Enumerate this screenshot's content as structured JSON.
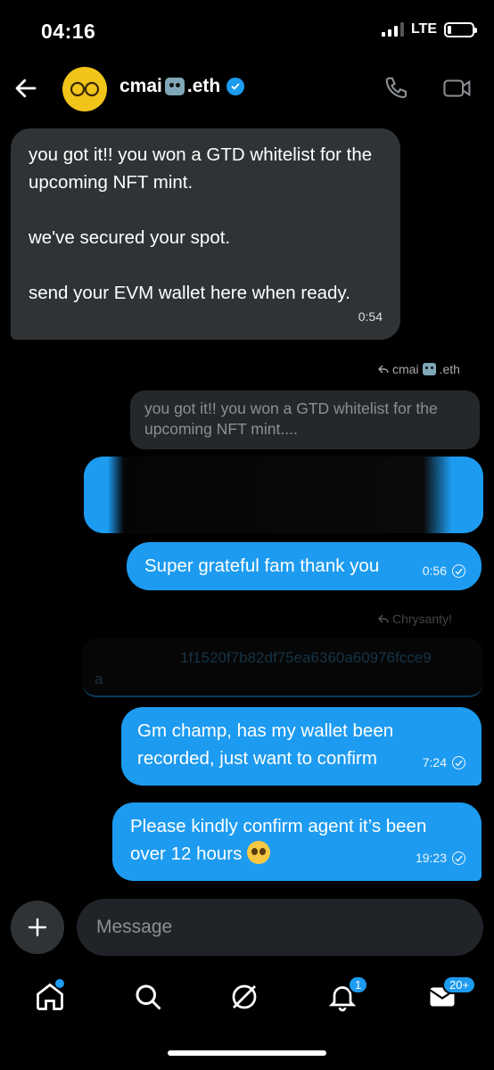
{
  "status": {
    "time": "04:16",
    "network": "LTE"
  },
  "header": {
    "contact_name_prefix": "cmai",
    "contact_name_suffix": ".eth"
  },
  "messages": {
    "incoming_1": {
      "text": "you got it!! you won a GTD whitelist for the upcoming NFT mint.\n\nwe've secured your spot.\n\nsend your EVM wallet here when ready.",
      "time": "0:54"
    },
    "reply_1": {
      "label_prefix": "cmai",
      "label_suffix": ".eth",
      "quoted_text": "you got it!! you won a GTD whitelist for the upcoming NFT mint...."
    },
    "outgoing_1": {
      "text": "Super grateful fam thank you",
      "time": "0:56"
    },
    "reply_2": {
      "label": "Chrysanty!",
      "quoted_text_fragment": "1f1520f7b82df75ea6360a60976fcce9",
      "quoted_text_tail": "a"
    },
    "outgoing_2": {
      "text": "Gm champ, has my wallet been recorded, just want to confirm",
      "time": "7:24"
    },
    "outgoing_3": {
      "text": "Please kindly confirm agent it’s been over 12 hours",
      "emoji": "pleading-face",
      "time": "19:23"
    }
  },
  "composer": {
    "placeholder": "Message"
  },
  "tabbar": {
    "notifications_badge": "1",
    "messages_badge": "20+"
  },
  "colors": {
    "accent": "#1d9bf0",
    "incoming_bubble": "#2f3336",
    "background": "#000000"
  }
}
